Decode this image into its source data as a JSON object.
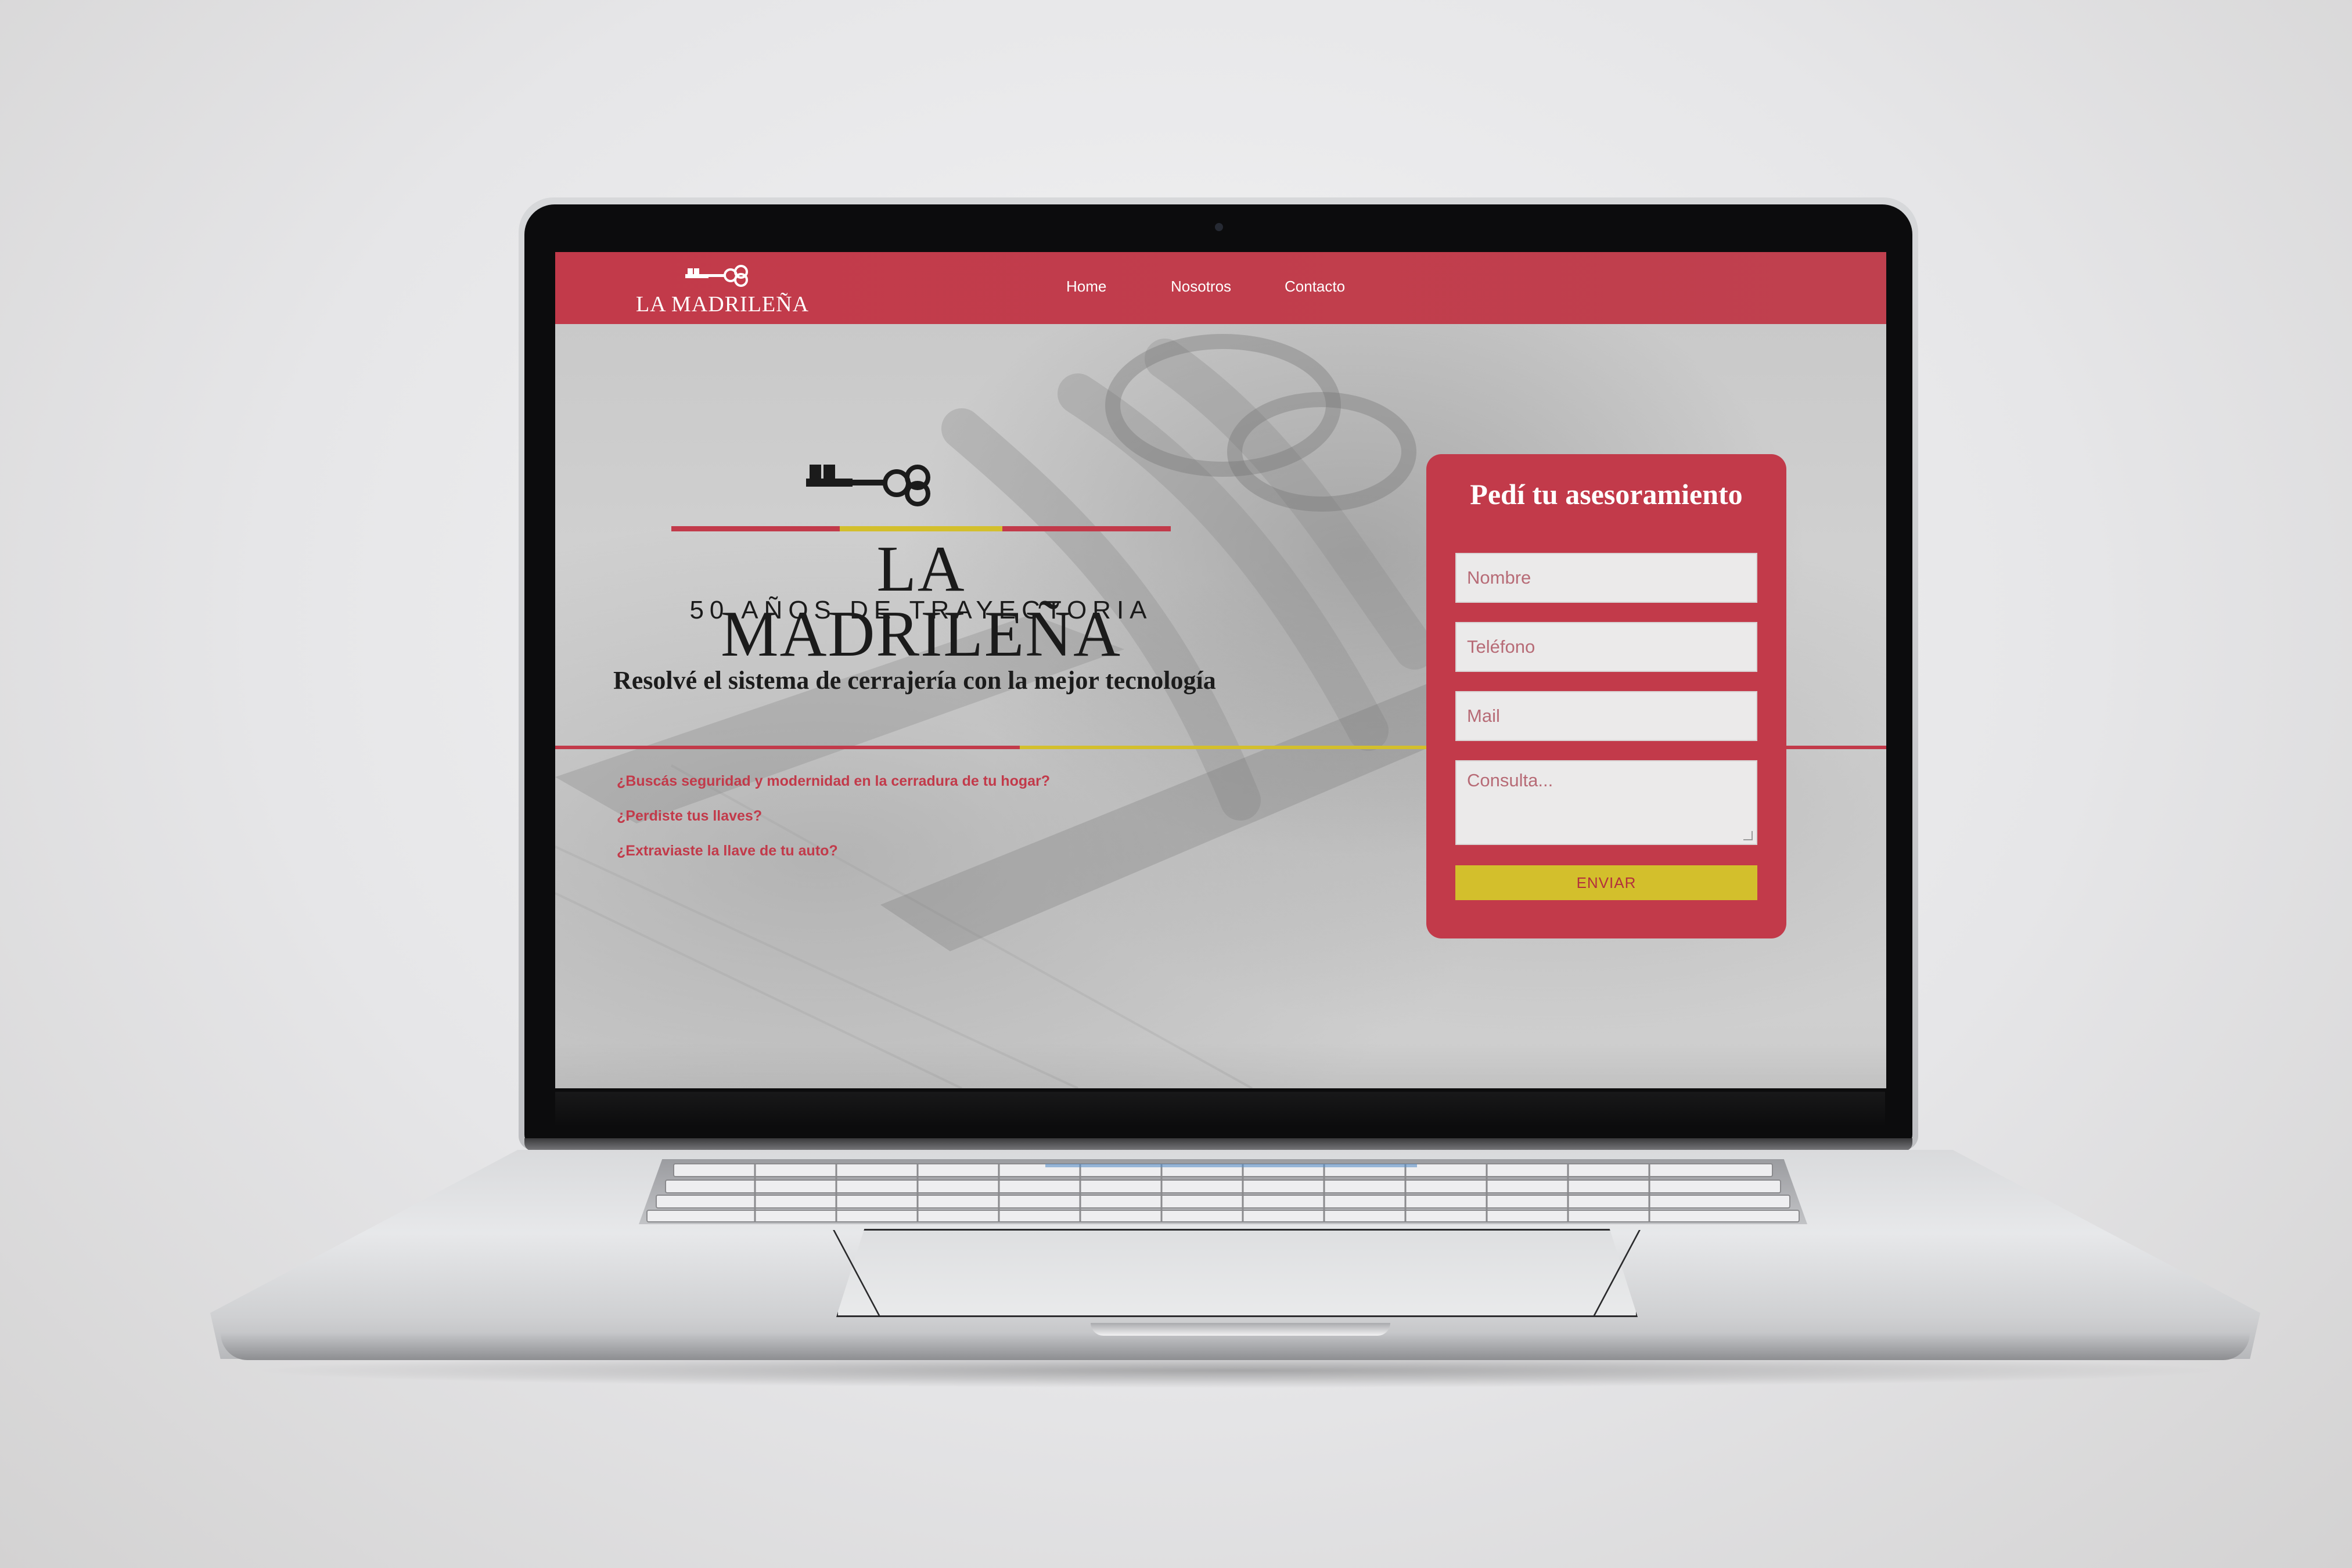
{
  "nav": {
    "logo_text": "LA MADRILEÑA",
    "links": [
      "Home",
      "Nosotros",
      "Contacto"
    ]
  },
  "hero": {
    "brand": "LA MADRILEÑA",
    "brand_sub": "50 AÑOS DE TRAYECTORIA",
    "tagline": "Resolvé el sistema de cerrajería con la mejor tecnología",
    "questions": [
      "¿Buscás seguridad y modernidad en la cerradura de tu hogar?",
      "¿Perdiste tus llaves?",
      "¿Extraviaste la llave de tu auto?"
    ]
  },
  "form": {
    "title": "Pedí tu asesoramiento",
    "name_placeholder": "Nombre",
    "phone_placeholder": "Teléfono",
    "mail_placeholder": "Mail",
    "message_placeholder": "Consulta...",
    "submit_label": "ENVIAR"
  },
  "colors": {
    "brand_red": "#c23a4a",
    "brand_yellow": "#d3bf2c",
    "dark": "#1b1b1b"
  },
  "icons": [
    "key-icon"
  ]
}
